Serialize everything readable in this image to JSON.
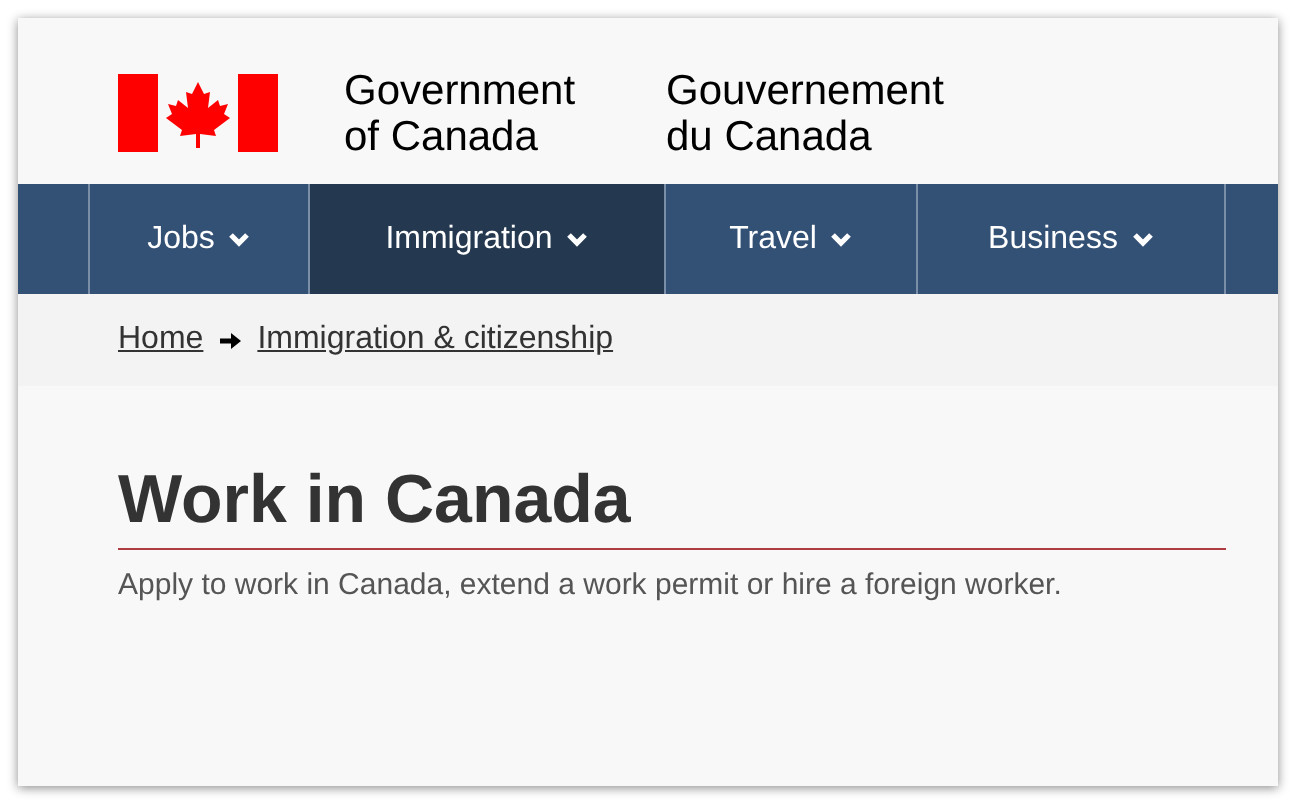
{
  "header": {
    "name_en": [
      "Government",
      "of Canada"
    ],
    "name_fr": [
      "Gouvernement",
      "du Canada"
    ]
  },
  "menu": [
    {
      "label": "Jobs",
      "selected": false
    },
    {
      "label": "Immigration",
      "selected": true
    },
    {
      "label": "Travel",
      "selected": false
    },
    {
      "label": "Business",
      "selected": false
    }
  ],
  "breadcrumb": [
    "Home",
    "Immigration & citizenship"
  ],
  "page": {
    "title": "Work in Canada",
    "intro": "Apply to work in Canada, extend a work permit or hire a foreign worker."
  }
}
